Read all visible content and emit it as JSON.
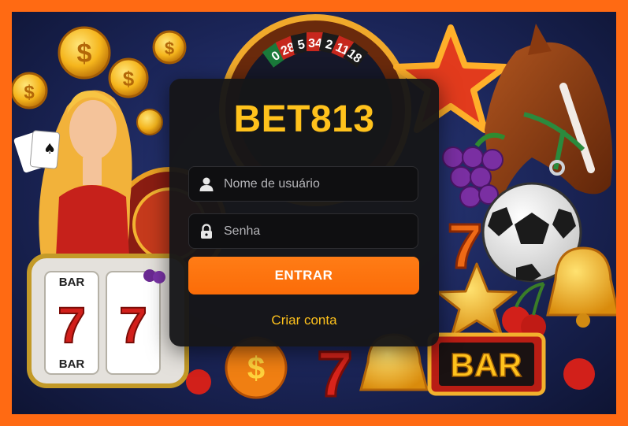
{
  "login": {
    "brand": "BET813",
    "username_placeholder": "Nome de usuário",
    "password_placeholder": "Senha",
    "submit_label": "ENTRAR",
    "signup_label": "Criar conta"
  },
  "background": {
    "roulette_numbers": [
      "0",
      "28",
      "5",
      "34",
      "2",
      "11",
      "18"
    ],
    "slot_symbols": [
      "BAR",
      "7",
      "BAR"
    ],
    "bar_sign": "BAR",
    "icons": [
      "casino-woman-with-cards",
      "gold-coin",
      "roulette-wheel",
      "star",
      "horse-head",
      "grapes",
      "soccer-ball",
      "lucky-seven",
      "bell",
      "cherries",
      "slot-machine"
    ]
  },
  "colors": {
    "border": "#ff6a13",
    "brand": "#ffc21c",
    "button": "#fb6c08",
    "card": "#161618"
  }
}
